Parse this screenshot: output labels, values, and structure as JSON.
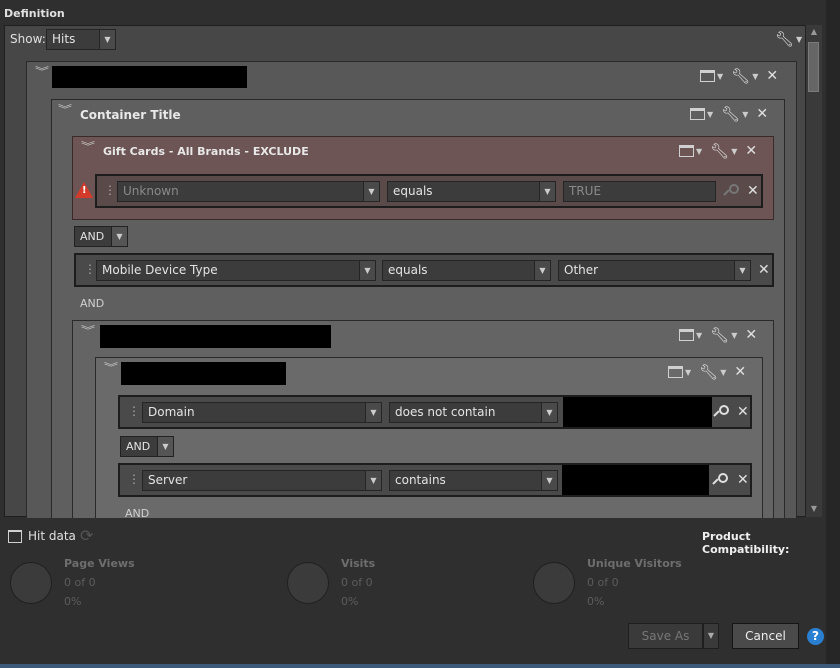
{
  "header": {
    "title": "Definition"
  },
  "show": {
    "label": "Show:",
    "value": "Hits"
  },
  "containers": {
    "container_title": "Container Title",
    "exclude_title": "Gift Cards - All Brands - EXCLUDE"
  },
  "rules": {
    "unknown": {
      "dimension": "Unknown",
      "operator": "equals",
      "value": "TRUE"
    },
    "mobile": {
      "dimension": "Mobile Device Type",
      "operator": "equals",
      "value": "Other"
    },
    "domain": {
      "dimension": "Domain",
      "operator": "does not contain"
    },
    "server": {
      "dimension": "Server",
      "operator": "contains"
    }
  },
  "logic": {
    "and": "AND"
  },
  "bottom": {
    "hit_data": "Hit data",
    "product_compat": "Product Compatibility:",
    "metrics": [
      {
        "title": "Page Views",
        "count": "0 of 0",
        "pct": "0%"
      },
      {
        "title": "Visits",
        "count": "0 of 0",
        "pct": "0%"
      },
      {
        "title": "Unique Visitors",
        "count": "0 of 0",
        "pct": "0%"
      }
    ],
    "save_as": "Save As",
    "cancel": "Cancel",
    "help": "?"
  },
  "icons": {
    "wrench": "wrench-icon",
    "window": "window-icon",
    "close": "close-icon",
    "collapse": "double-chevron-icon",
    "search": "search-icon",
    "warning": "warning-icon",
    "refresh": "refresh-icon"
  },
  "colors": {
    "exclude_bg": "#6e5555",
    "warning": "#d43a2a",
    "help": "#2a7fd0"
  }
}
